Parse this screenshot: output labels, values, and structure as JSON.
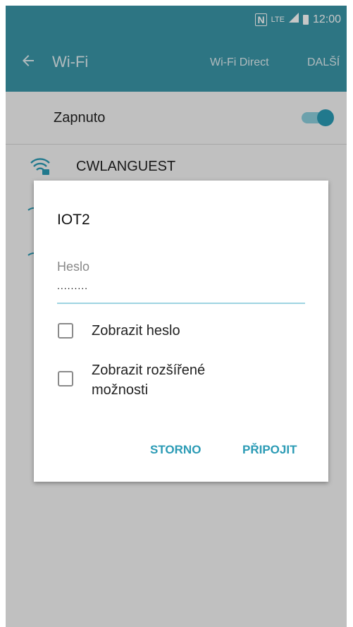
{
  "status_bar": {
    "nfc": "N",
    "net_small": "LTE",
    "time": "12:00"
  },
  "app_bar": {
    "title": "Wi-Fi",
    "wifi_direct": "Wi-Fi Direct",
    "more": "DALŠÍ"
  },
  "wifi_toggle": {
    "label": "Zapnuto",
    "on": true
  },
  "network": {
    "name": "CWLANGUEST"
  },
  "dialog": {
    "title": "IOT2",
    "password_label": "Heslo",
    "password_value": ".........",
    "show_password": "Zobrazit heslo",
    "advanced_options": "Zobrazit rozšířené možnosti",
    "cancel": "STORNO",
    "connect": "PŘIPOJIT"
  },
  "colors": {
    "accent": "#3a96a8",
    "button_text": "#2b9bb5"
  }
}
